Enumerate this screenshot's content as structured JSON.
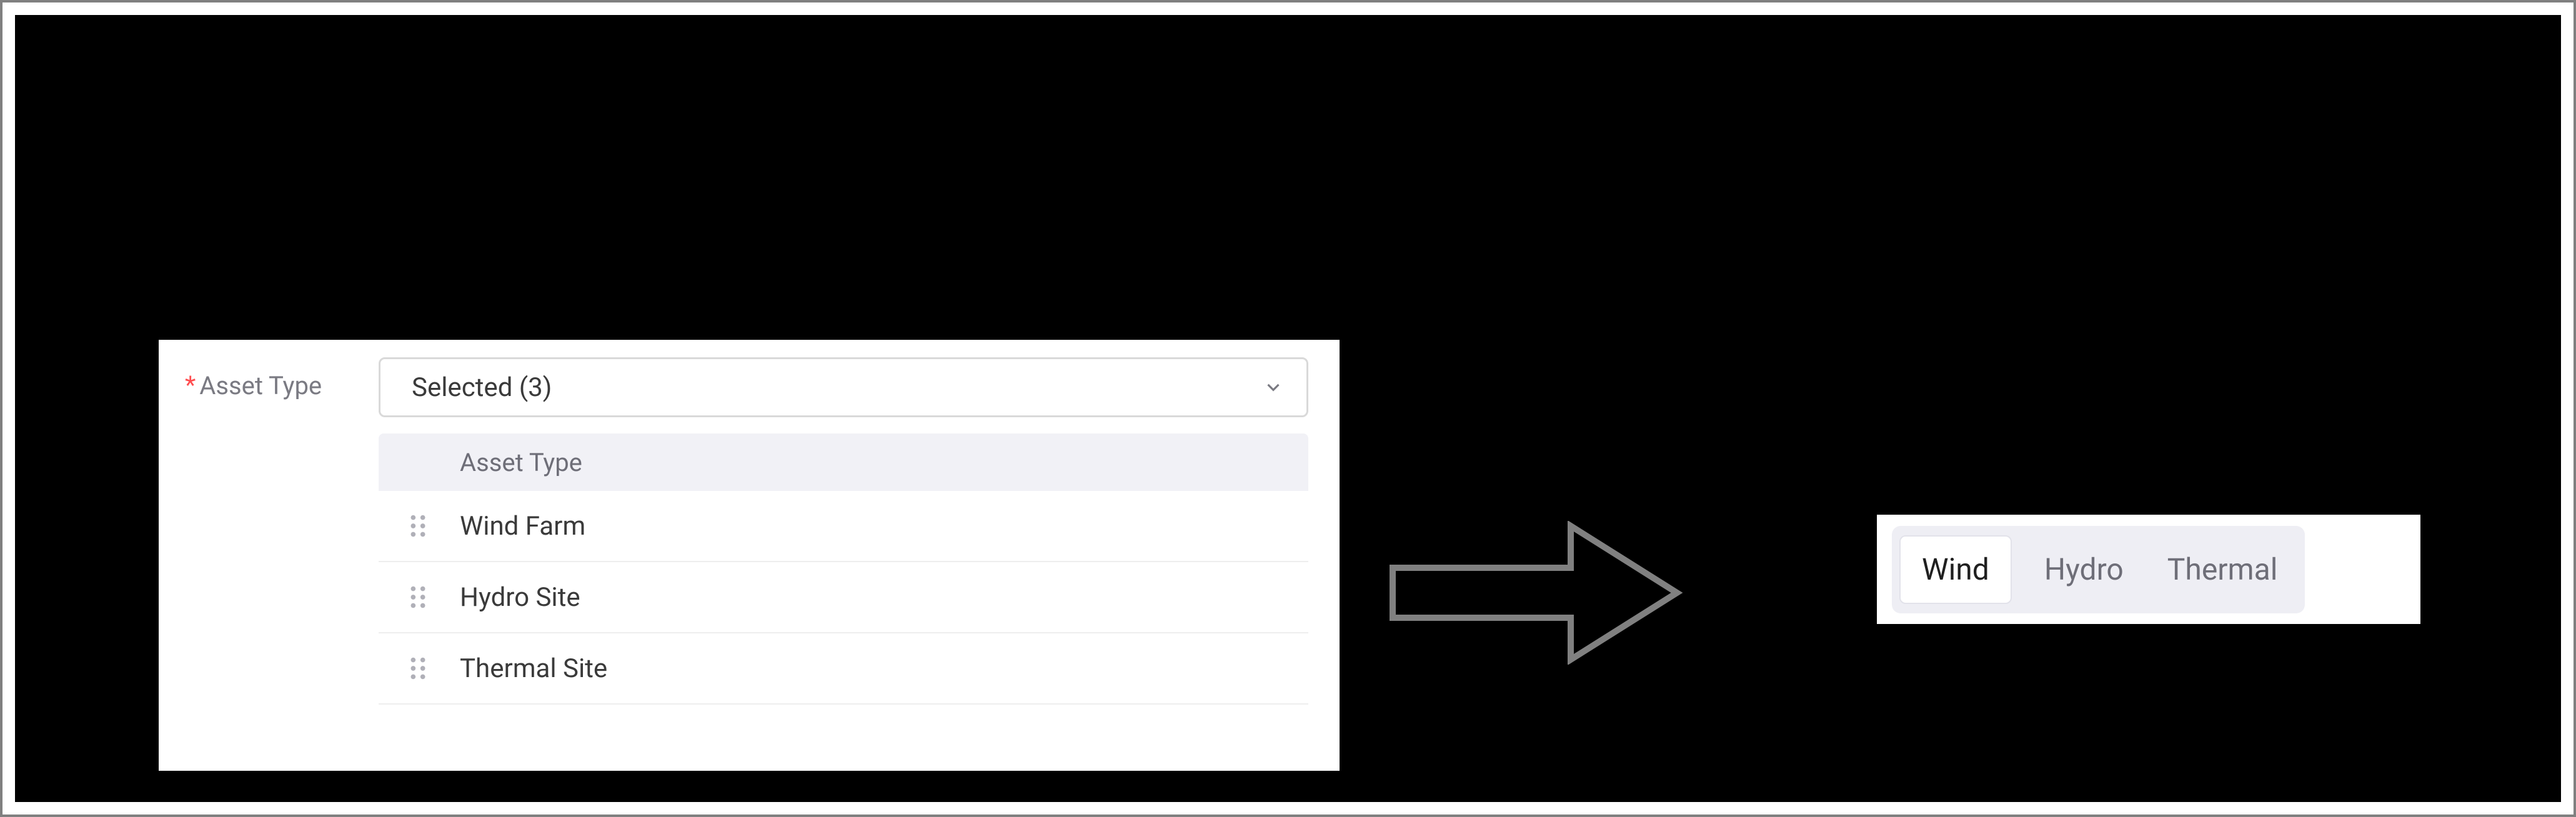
{
  "form": {
    "label": "Asset Type",
    "required_marker": "*",
    "select_value": "Selected (3)",
    "list_header": "Asset Type",
    "items": [
      {
        "label": "Wind Farm"
      },
      {
        "label": "Hydro Site"
      },
      {
        "label": "Thermal Site"
      }
    ]
  },
  "tabs": {
    "items": [
      {
        "label": "Wind",
        "active": true
      },
      {
        "label": "Hydro",
        "active": false
      },
      {
        "label": "Thermal",
        "active": false
      }
    ]
  }
}
